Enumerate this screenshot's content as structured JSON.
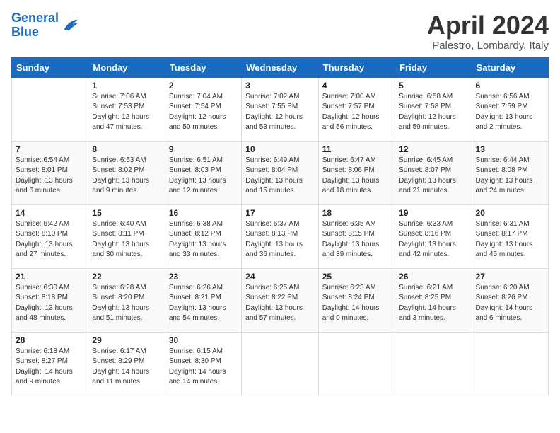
{
  "header": {
    "logo_general": "General",
    "logo_blue": "Blue",
    "month_title": "April 2024",
    "location": "Palestro, Lombardy, Italy"
  },
  "weekdays": [
    "Sunday",
    "Monday",
    "Tuesday",
    "Wednesday",
    "Thursday",
    "Friday",
    "Saturday"
  ],
  "weeks": [
    [
      {
        "day": "",
        "sunrise": "",
        "sunset": "",
        "daylight": ""
      },
      {
        "day": "1",
        "sunrise": "Sunrise: 7:06 AM",
        "sunset": "Sunset: 7:53 PM",
        "daylight": "Daylight: 12 hours and 47 minutes."
      },
      {
        "day": "2",
        "sunrise": "Sunrise: 7:04 AM",
        "sunset": "Sunset: 7:54 PM",
        "daylight": "Daylight: 12 hours and 50 minutes."
      },
      {
        "day": "3",
        "sunrise": "Sunrise: 7:02 AM",
        "sunset": "Sunset: 7:55 PM",
        "daylight": "Daylight: 12 hours and 53 minutes."
      },
      {
        "day": "4",
        "sunrise": "Sunrise: 7:00 AM",
        "sunset": "Sunset: 7:57 PM",
        "daylight": "Daylight: 12 hours and 56 minutes."
      },
      {
        "day": "5",
        "sunrise": "Sunrise: 6:58 AM",
        "sunset": "Sunset: 7:58 PM",
        "daylight": "Daylight: 12 hours and 59 minutes."
      },
      {
        "day": "6",
        "sunrise": "Sunrise: 6:56 AM",
        "sunset": "Sunset: 7:59 PM",
        "daylight": "Daylight: 13 hours and 2 minutes."
      }
    ],
    [
      {
        "day": "7",
        "sunrise": "Sunrise: 6:54 AM",
        "sunset": "Sunset: 8:01 PM",
        "daylight": "Daylight: 13 hours and 6 minutes."
      },
      {
        "day": "8",
        "sunrise": "Sunrise: 6:53 AM",
        "sunset": "Sunset: 8:02 PM",
        "daylight": "Daylight: 13 hours and 9 minutes."
      },
      {
        "day": "9",
        "sunrise": "Sunrise: 6:51 AM",
        "sunset": "Sunset: 8:03 PM",
        "daylight": "Daylight: 13 hours and 12 minutes."
      },
      {
        "day": "10",
        "sunrise": "Sunrise: 6:49 AM",
        "sunset": "Sunset: 8:04 PM",
        "daylight": "Daylight: 13 hours and 15 minutes."
      },
      {
        "day": "11",
        "sunrise": "Sunrise: 6:47 AM",
        "sunset": "Sunset: 8:06 PM",
        "daylight": "Daylight: 13 hours and 18 minutes."
      },
      {
        "day": "12",
        "sunrise": "Sunrise: 6:45 AM",
        "sunset": "Sunset: 8:07 PM",
        "daylight": "Daylight: 13 hours and 21 minutes."
      },
      {
        "day": "13",
        "sunrise": "Sunrise: 6:44 AM",
        "sunset": "Sunset: 8:08 PM",
        "daylight": "Daylight: 13 hours and 24 minutes."
      }
    ],
    [
      {
        "day": "14",
        "sunrise": "Sunrise: 6:42 AM",
        "sunset": "Sunset: 8:10 PM",
        "daylight": "Daylight: 13 hours and 27 minutes."
      },
      {
        "day": "15",
        "sunrise": "Sunrise: 6:40 AM",
        "sunset": "Sunset: 8:11 PM",
        "daylight": "Daylight: 13 hours and 30 minutes."
      },
      {
        "day": "16",
        "sunrise": "Sunrise: 6:38 AM",
        "sunset": "Sunset: 8:12 PM",
        "daylight": "Daylight: 13 hours and 33 minutes."
      },
      {
        "day": "17",
        "sunrise": "Sunrise: 6:37 AM",
        "sunset": "Sunset: 8:13 PM",
        "daylight": "Daylight: 13 hours and 36 minutes."
      },
      {
        "day": "18",
        "sunrise": "Sunrise: 6:35 AM",
        "sunset": "Sunset: 8:15 PM",
        "daylight": "Daylight: 13 hours and 39 minutes."
      },
      {
        "day": "19",
        "sunrise": "Sunrise: 6:33 AM",
        "sunset": "Sunset: 8:16 PM",
        "daylight": "Daylight: 13 hours and 42 minutes."
      },
      {
        "day": "20",
        "sunrise": "Sunrise: 6:31 AM",
        "sunset": "Sunset: 8:17 PM",
        "daylight": "Daylight: 13 hours and 45 minutes."
      }
    ],
    [
      {
        "day": "21",
        "sunrise": "Sunrise: 6:30 AM",
        "sunset": "Sunset: 8:18 PM",
        "daylight": "Daylight: 13 hours and 48 minutes."
      },
      {
        "day": "22",
        "sunrise": "Sunrise: 6:28 AM",
        "sunset": "Sunset: 8:20 PM",
        "daylight": "Daylight: 13 hours and 51 minutes."
      },
      {
        "day": "23",
        "sunrise": "Sunrise: 6:26 AM",
        "sunset": "Sunset: 8:21 PM",
        "daylight": "Daylight: 13 hours and 54 minutes."
      },
      {
        "day": "24",
        "sunrise": "Sunrise: 6:25 AM",
        "sunset": "Sunset: 8:22 PM",
        "daylight": "Daylight: 13 hours and 57 minutes."
      },
      {
        "day": "25",
        "sunrise": "Sunrise: 6:23 AM",
        "sunset": "Sunset: 8:24 PM",
        "daylight": "Daylight: 14 hours and 0 minutes."
      },
      {
        "day": "26",
        "sunrise": "Sunrise: 6:21 AM",
        "sunset": "Sunset: 8:25 PM",
        "daylight": "Daylight: 14 hours and 3 minutes."
      },
      {
        "day": "27",
        "sunrise": "Sunrise: 6:20 AM",
        "sunset": "Sunset: 8:26 PM",
        "daylight": "Daylight: 14 hours and 6 minutes."
      }
    ],
    [
      {
        "day": "28",
        "sunrise": "Sunrise: 6:18 AM",
        "sunset": "Sunset: 8:27 PM",
        "daylight": "Daylight: 14 hours and 9 minutes."
      },
      {
        "day": "29",
        "sunrise": "Sunrise: 6:17 AM",
        "sunset": "Sunset: 8:29 PM",
        "daylight": "Daylight: 14 hours and 11 minutes."
      },
      {
        "day": "30",
        "sunrise": "Sunrise: 6:15 AM",
        "sunset": "Sunset: 8:30 PM",
        "daylight": "Daylight: 14 hours and 14 minutes."
      },
      {
        "day": "",
        "sunrise": "",
        "sunset": "",
        "daylight": ""
      },
      {
        "day": "",
        "sunrise": "",
        "sunset": "",
        "daylight": ""
      },
      {
        "day": "",
        "sunrise": "",
        "sunset": "",
        "daylight": ""
      },
      {
        "day": "",
        "sunrise": "",
        "sunset": "",
        "daylight": ""
      }
    ]
  ]
}
